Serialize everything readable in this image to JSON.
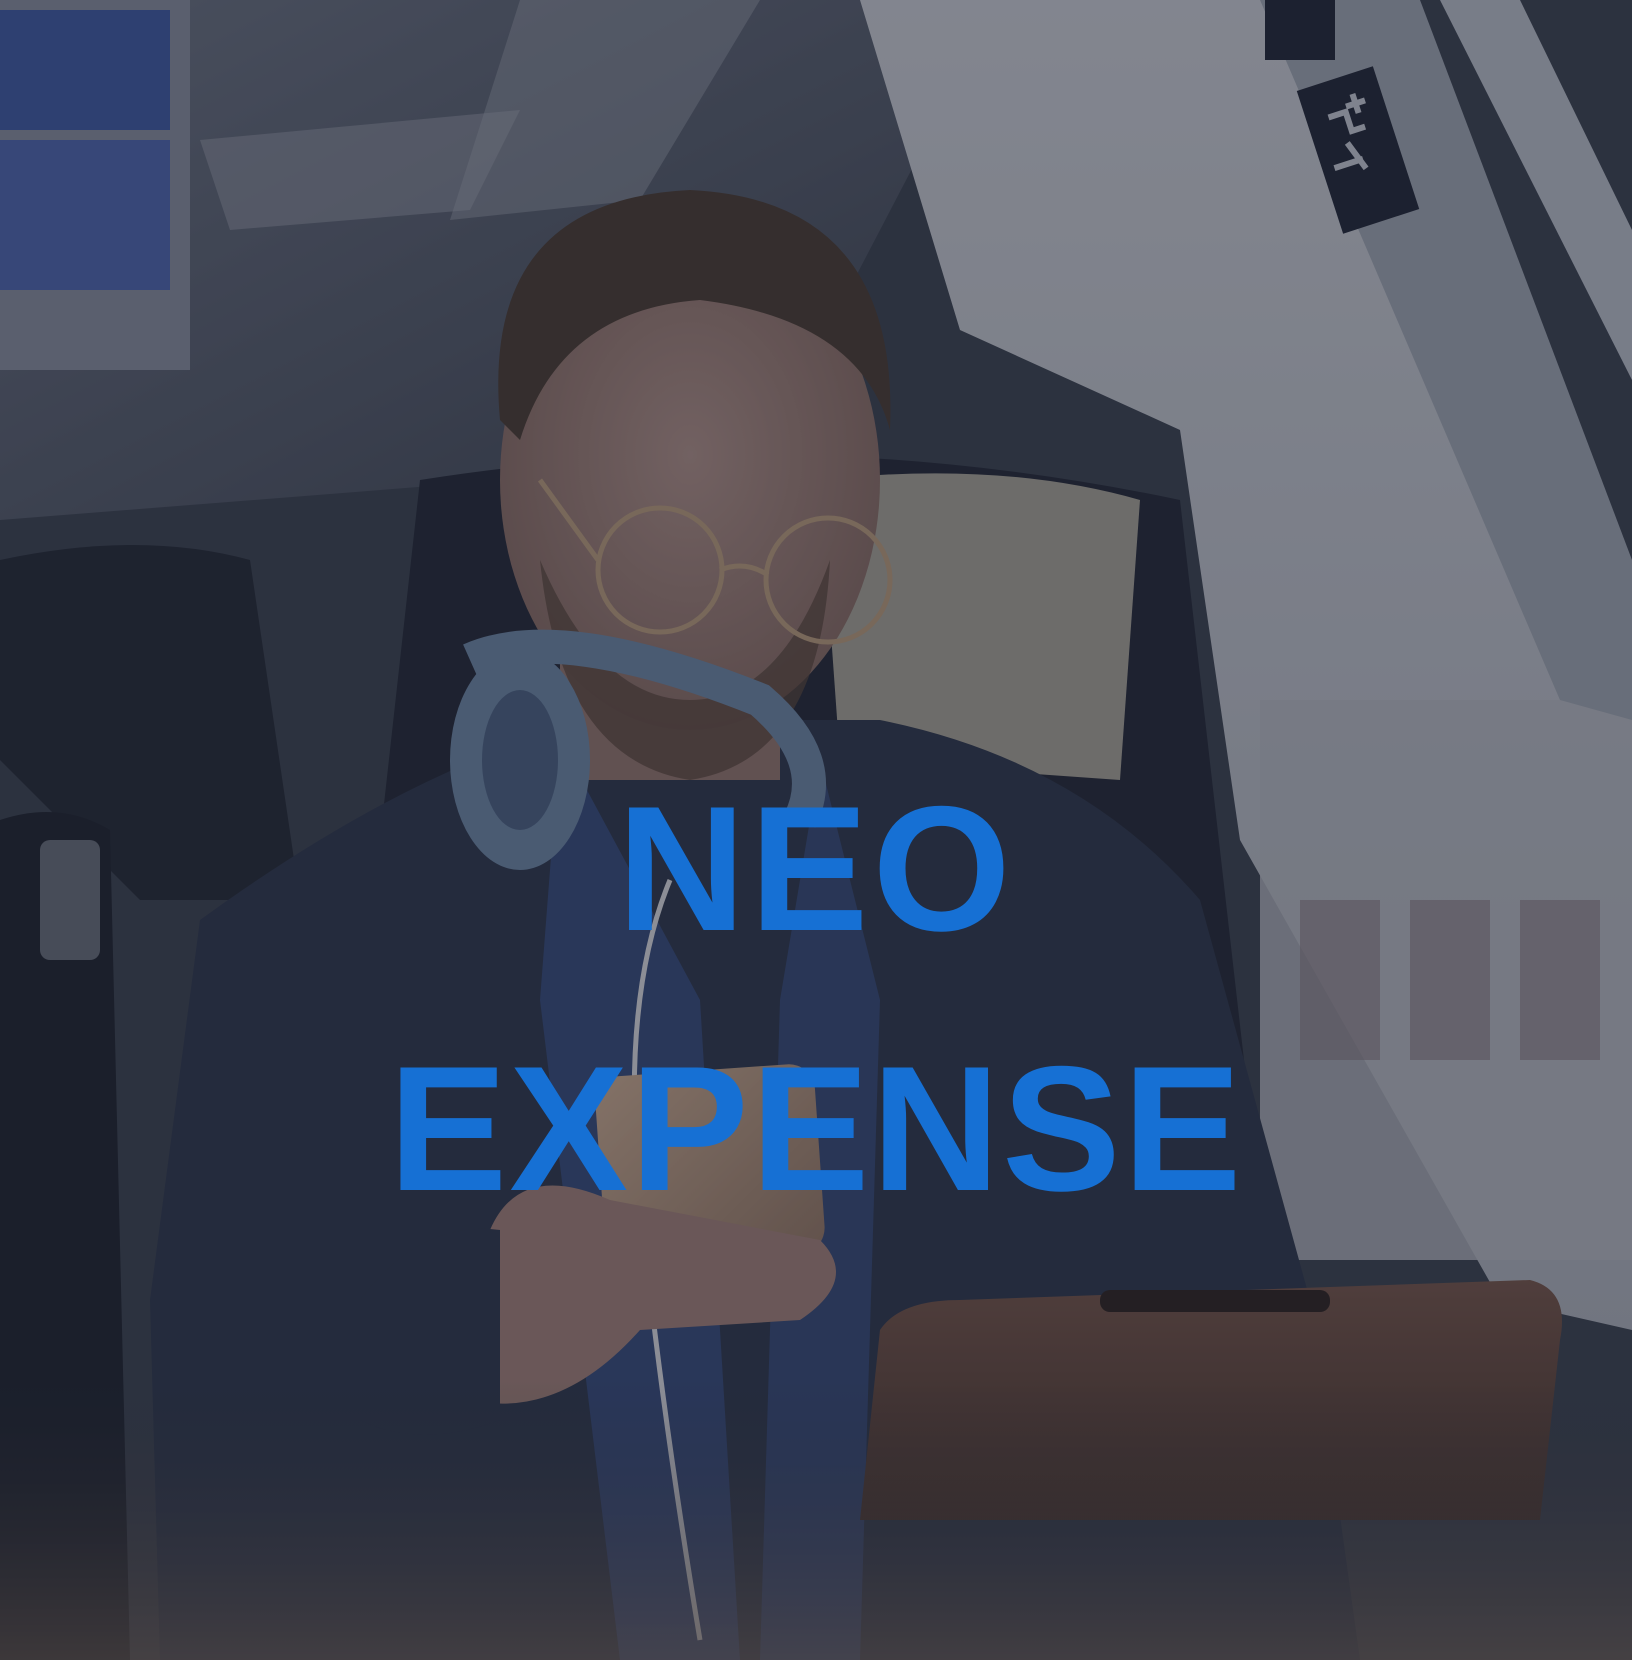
{
  "title": {
    "line1": "NEO",
    "line2": "EXPENSE"
  },
  "colors": {
    "title": "#1670D4",
    "overlay": "#1c2230",
    "window_light": "#c9ccd2",
    "jacket": "#2b3447",
    "skin": "#a8867a",
    "hair": "#4a3a2c",
    "seat_dark": "#20252f",
    "seat_cream": "#c9c1ac",
    "tablet_case": "#6e4e3e",
    "headphones": "#6f8aa8",
    "shirt": "#34497a"
  },
  "icons": {
    "signs": "seat-reservation-signs-icon"
  }
}
